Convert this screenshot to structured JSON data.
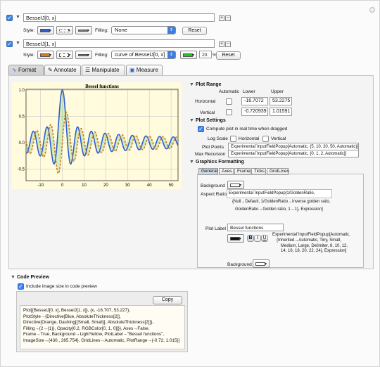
{
  "functions": [
    {
      "expr": "BesselJ[0, x]",
      "style_label": "Style:",
      "filling_label": "Filling:",
      "filling_value": "None",
      "reset": "Reset",
      "color": "#2f5bd6"
    },
    {
      "expr": "BesselJ[1, x]",
      "style_label": "Style:",
      "filling_label": "Filling:",
      "filling_value": "curve of BesselJ[0, x]",
      "fill_opacity": "20.",
      "fill_opacity_unit": "%",
      "reset": "Reset",
      "color": "#d07a2a",
      "fill_color": "#2ebd2e"
    }
  ],
  "tabs": [
    "Format",
    "Annotate",
    "Manipulate",
    "Measure"
  ],
  "plot_range": {
    "title": "Plot Range",
    "headers": [
      "Automatic",
      "Lower",
      "Upper"
    ],
    "rows": [
      {
        "label": "Horizontal",
        "lower": "-16.7072",
        "upper": "53.2275"
      },
      {
        "label": "Vertical",
        "lower": "-0.720939",
        "upper": "1.01591"
      }
    ]
  },
  "plot_settings": {
    "title": "Plot Settings",
    "compute_label": "Compute plot in real time when dragged",
    "log_scale_label": "Log Scale",
    "horizontal": "Horizontal",
    "vertical": "Vertical",
    "plot_points_label": "Plot Points",
    "plot_points_value": "Experimental`InputFieldPopup[Automatic, {5, 10, 20, 50, Automatic}]",
    "max_recursion_label": "Max Recursion",
    "max_recursion_value": "Experimental`InputFieldPopup[Automatic, {0, 1, 2, Automatic}]"
  },
  "graphics_formatting": {
    "title": "Graphics Formatting",
    "subtabs": [
      "General",
      "Axes",
      "Frame",
      "Ticks",
      "GridLines"
    ],
    "background_label": "Background",
    "aspect_ratio_label": "Aspect Ratio",
    "aspect_lines": [
      "Experimental`InputFieldPopup[1/GoldenRatio,",
      "{Null→Default, 1/GoldenRatio→Inverse golden ratio,",
      "GoldenRatio→Golden ratio, 1→1}, Expression]"
    ],
    "plot_label_label": "Plot Label",
    "plot_label_value": "Bessel functions",
    "style_bold": "B",
    "style_italic": "I",
    "style_underline": "U",
    "size_popup_lines": [
      "Experimental`InputFieldPopup[Automatic,",
      "{Inherited→Automatic, Tiny, Small,",
      "Medium, Large, Delimiter, 8, 10, 12,",
      "14, 16, 18, 20, 22, 24}, Expression]"
    ],
    "background2_label": "Background"
  },
  "code_preview": {
    "title": "Code Preview",
    "include_label": "Include image size in code preview",
    "copy": "Copy",
    "lines": [
      "Plot[{BesselJ[0, x], BesselJ[1, x]}, {x, -16.707, 53.227},",
      "  PlotStyle→{Directive[Blue, AbsoluteThickness[2]],",
      "      Directive[Orange, Dashing[{Small, Small}], AbsoluteThickness[2]]},",
      "  Filling→{2→{1}}, Opacity[0.2, RGBColor[0, 1, 0]]}}, Axes→False,",
      "  Frame→True, Background→LightYellow, PlotLabel→\"Bessel functions\",",
      "  ImageSize→{430., 265.754}, GridLines→Automatic, PlotRange→{-0.72, 1.015}]"
    ]
  },
  "chart_data": {
    "type": "line",
    "title": "Bessel functions",
    "xlim": [
      -16.7,
      53.2
    ],
    "ylim": [
      -0.72,
      1.015
    ],
    "x_ticks": [
      "-10",
      "0",
      "10",
      "20",
      "30",
      "40",
      "50"
    ],
    "y_ticks": [
      "1.0",
      "0.5",
      "0.0",
      "-0.5"
    ],
    "series": [
      {
        "color": "#2f5bd6",
        "style": "solid",
        "x": [
          -16,
          -12,
          -8,
          -4,
          -2,
          0,
          2,
          4,
          6,
          8,
          12,
          16,
          20,
          30,
          40,
          50
        ],
        "values": [
          -0.17,
          0.05,
          0.17,
          -0.4,
          0.22,
          1.0,
          0.22,
          -0.4,
          0.15,
          0.17,
          0.05,
          -0.17,
          0.17,
          -0.09,
          0.01,
          0.06
        ]
      },
      {
        "color": "#d07a2a",
        "style": "dashed",
        "x": [
          -16,
          -12,
          -8,
          -4,
          -2,
          0,
          2,
          4,
          6,
          8,
          12,
          16,
          20,
          30,
          40,
          50
        ],
        "values": [
          -0.09,
          0.22,
          -0.23,
          0.07,
          -0.58,
          0.0,
          0.58,
          -0.07,
          -0.28,
          0.23,
          -0.22,
          0.09,
          0.07,
          -0.12,
          0.13,
          -0.1
        ]
      }
    ],
    "fill": {
      "color": "#2ebd2e",
      "opacity": 0.2
    },
    "background": "#fffbdc",
    "grid": true
  }
}
